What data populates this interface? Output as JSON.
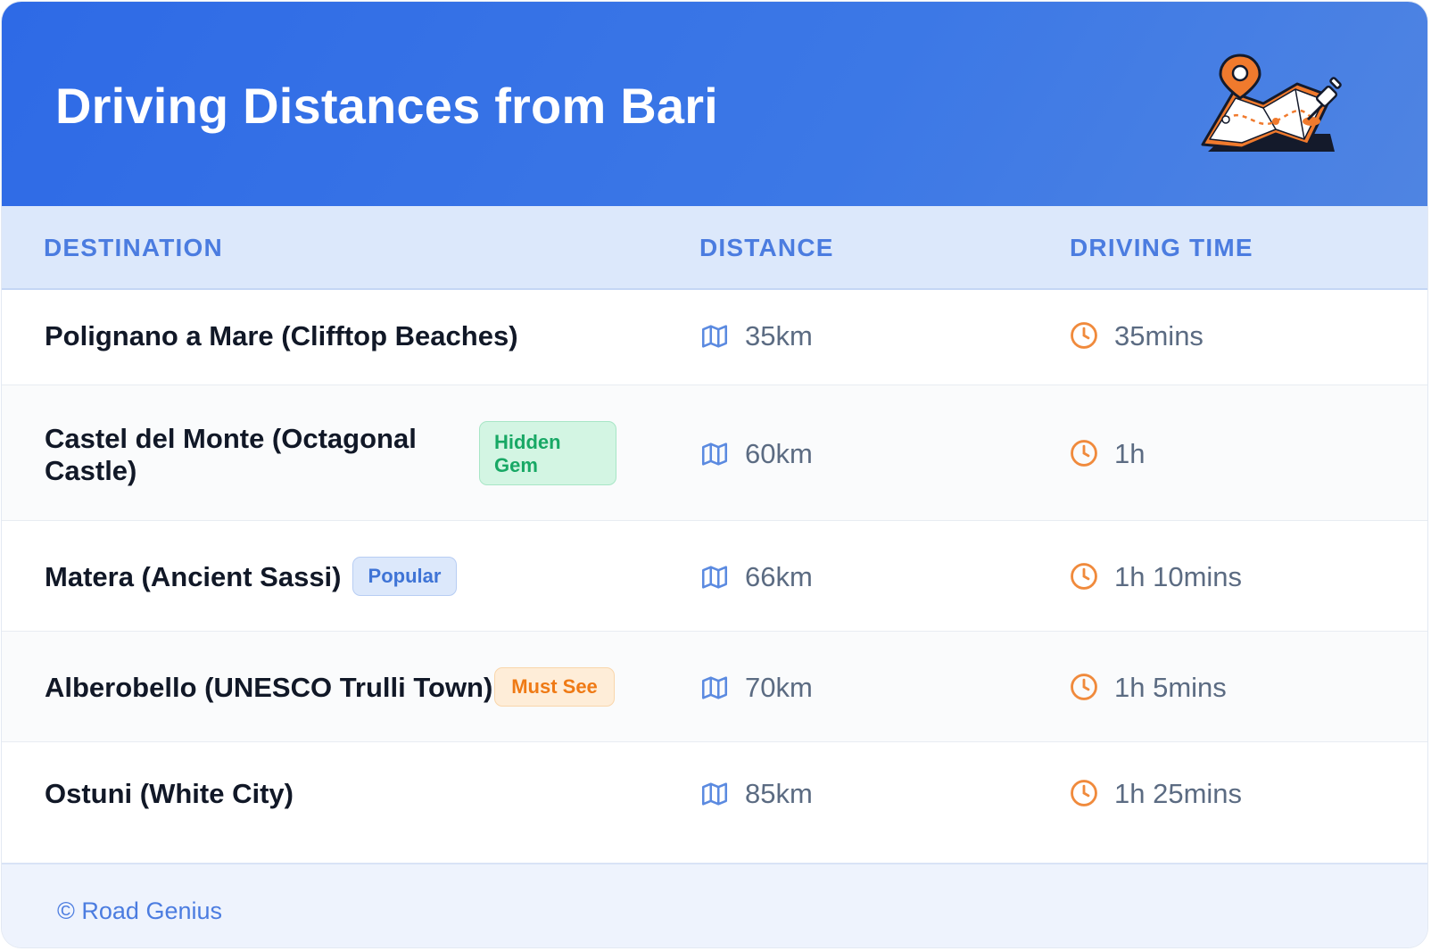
{
  "header": {
    "title": "Driving Distances from Bari",
    "illustration": "map-with-pins-icon"
  },
  "table": {
    "columns": [
      "DESTINATION",
      "DISTANCE",
      "DRIVING TIME"
    ],
    "rows": [
      {
        "destination": "Polignano a Mare (Clifftop Beaches)",
        "badge": "",
        "distance": "35km",
        "time": "35mins"
      },
      {
        "destination_line1": "Castel del Monte (Octagonal",
        "destination_line2": "Castle)",
        "badge_line1": "Hidden",
        "badge_line2": "Gem",
        "badge_color": "green",
        "distance": "60km",
        "time": "1h"
      },
      {
        "destination": "Matera (Ancient Sassi)",
        "badge": "Popular",
        "badge_color": "blue",
        "distance": "66km",
        "time": "1h 10mins"
      },
      {
        "destination": "Alberobello (UNESCO Trulli Town)",
        "badge": "Must See",
        "badge_color": "orange",
        "distance": "70km",
        "time": "1h 5mins"
      },
      {
        "destination": "Ostuni (White City)",
        "badge": "",
        "distance": "85km",
        "time": "1h 25mins"
      }
    ],
    "distance_icon": "map-icon",
    "time_icon": "clock-icon"
  },
  "footer": {
    "copyright": "© Road Genius"
  },
  "colors": {
    "header_gradient_start": "#2e6ae6",
    "header_gradient_end": "#4f84e2",
    "column_header_text": "#4b7ce0",
    "clock_orange": "#f08a3c",
    "map_blue": "#5b8ae0"
  }
}
